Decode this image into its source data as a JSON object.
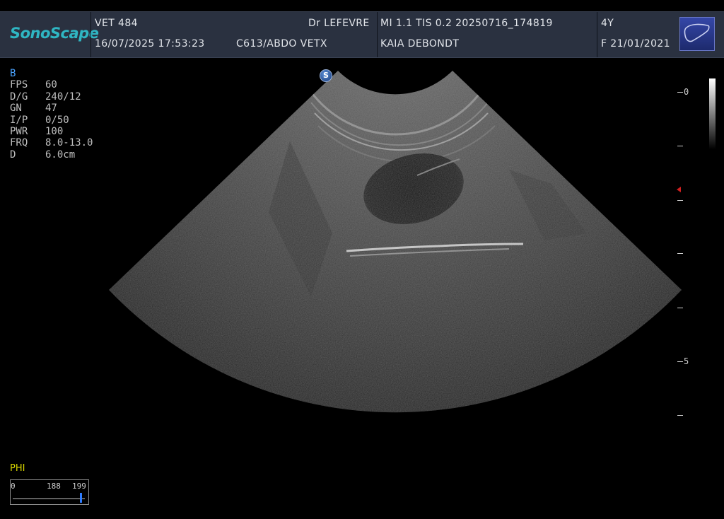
{
  "header": {
    "brand": "SonoScape",
    "id": "VET 484",
    "datetime": "16/07/2025 17:53:23",
    "doctor": "Dr LEFEVRE",
    "probe_preset": "C613/ABDO VETX",
    "safety": "MI 1.1  TIS 0.2  20250716_174819",
    "patient_name": "KAIA DEBONDT",
    "age": "4Y",
    "sex_dob": "F  21/01/2021",
    "organ_icon": "liver-icon"
  },
  "params": {
    "mode": "B",
    "rows": [
      {
        "k": "FPS",
        "v": "60"
      },
      {
        "k": "D/G",
        "v": "240/12"
      },
      {
        "k": "GN",
        "v": "47"
      },
      {
        "k": "I/P",
        "v": "0/50"
      },
      {
        "k": "PWR",
        "v": "100"
      },
      {
        "k": "FRQ",
        "v": "8.0-13.0"
      },
      {
        "k": "D",
        "v": "6.0cm"
      }
    ]
  },
  "depth_scale": {
    "labels": [
      "0",
      "5"
    ],
    "focus_marker_color": "#d02020"
  },
  "probe_badge": "S",
  "phi": {
    "label": "PHI",
    "min": "0",
    "current": "188",
    "max": "199",
    "level": 0.945
  }
}
